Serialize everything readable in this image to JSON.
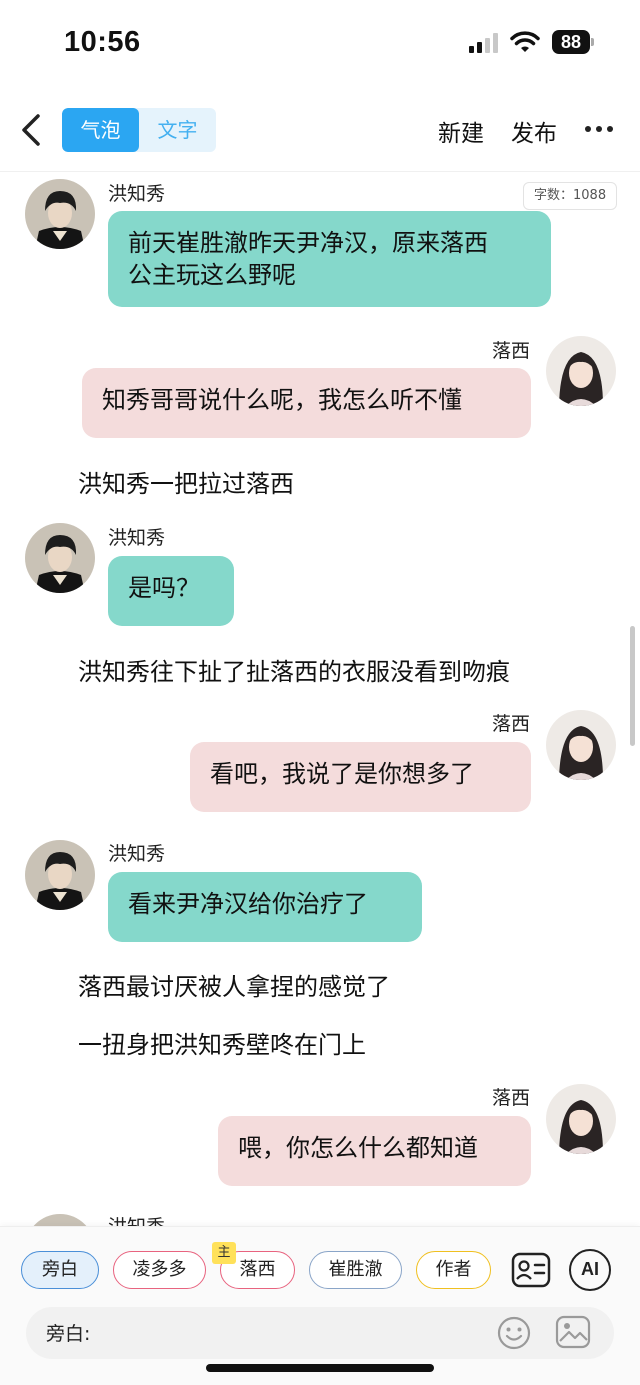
{
  "status_bar": {
    "time": "10:56",
    "battery": "88"
  },
  "nav": {
    "tabs": [
      "气泡",
      "文字"
    ],
    "active_tab": "气泡",
    "new_label": "新建",
    "publish_label": "发布"
  },
  "chat": {
    "word_count": "字数：1088",
    "items": [
      {
        "type": "message",
        "side": "left",
        "speaker": "洪知秀",
        "text_lines": [
          "前天崔胜澈昨天尹净汉，原来落西",
          "公主玩这么野呢"
        ]
      },
      {
        "type": "message",
        "side": "right",
        "speaker": "落西",
        "text_lines": [
          "知秀哥哥说什么呢，我怎么听不懂"
        ]
      },
      {
        "type": "narration",
        "text": "洪知秀一把拉过落西"
      },
      {
        "type": "message",
        "side": "left",
        "speaker": "洪知秀",
        "text_lines": [
          "是吗？"
        ]
      },
      {
        "type": "narration",
        "text": "洪知秀往下扯了扯落西的衣服没看到吻痕"
      },
      {
        "type": "message",
        "side": "right",
        "speaker": "落西",
        "text_lines": [
          "看吧，我说了是你想多了"
        ]
      },
      {
        "type": "message",
        "side": "left",
        "speaker": "洪知秀",
        "text_lines": [
          "看来尹净汉给你治疗了"
        ]
      },
      {
        "type": "narration",
        "text": "落西最讨厌被人拿捏的感觉了"
      },
      {
        "type": "narration",
        "text": "一扭身把洪知秀壁咚在门上"
      },
      {
        "type": "message",
        "side": "right",
        "speaker": "落西",
        "text_lines": [
          "喂，你怎么什么都知道"
        ]
      },
      {
        "type": "message",
        "side": "left",
        "speaker": "洪知秀",
        "text_lines": []
      }
    ]
  },
  "bottom": {
    "characters": [
      {
        "label": "旁白",
        "color": "#4a8fd8",
        "selected": true
      },
      {
        "label": "凌多多",
        "color": "#e8637f",
        "selected": false
      },
      {
        "label": "落西",
        "color": "#e8637f",
        "selected": false,
        "badge": "主"
      },
      {
        "label": "崔胜澈",
        "color": "#8aa5c8",
        "selected": false
      },
      {
        "label": "作者",
        "color": "#f0c020",
        "selected": false
      }
    ],
    "ai_label": "AI",
    "input_label": "旁白:"
  },
  "colors": {
    "accent_blue": "#2ba6f2",
    "bubble_teal": "#85d8cb",
    "bubble_pink": "#f4dcdc"
  }
}
